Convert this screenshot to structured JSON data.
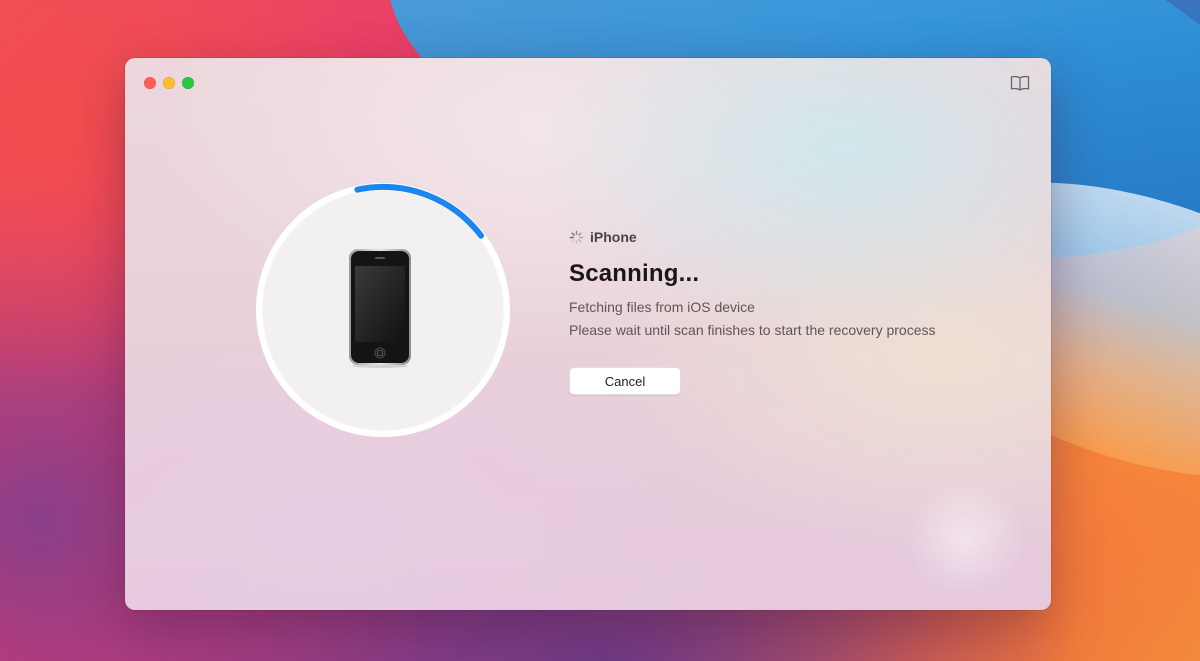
{
  "window": {
    "traffic_lights": {
      "close_color": "#ff5f57",
      "minimize_color": "#febc2e",
      "maximize_color": "#28c840"
    },
    "toolbar_icon": "book-icon"
  },
  "scan": {
    "progress": 0.18,
    "progress_color": "#1a86f0",
    "device_label": "iPhone",
    "title": "Scanning...",
    "status_line_1": "Fetching files from iOS device",
    "status_line_2": "Please wait until scan finishes to start the recovery process",
    "cancel_label": "Cancel"
  }
}
